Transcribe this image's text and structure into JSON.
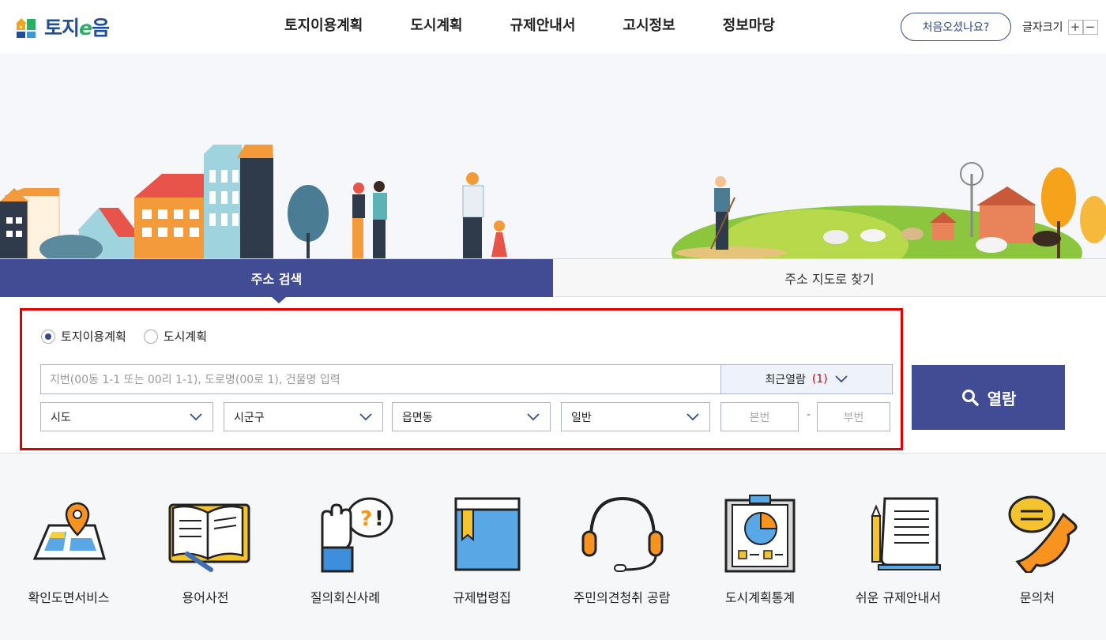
{
  "header": {
    "logo_text_a": "토지",
    "logo_text_e": "e",
    "logo_text_b": "음",
    "nav": [
      "토지이용계획",
      "도시계획",
      "규제안내서",
      "고시정보",
      "정보마당"
    ],
    "first_visit": "처음오셨나요?",
    "fontsize_label": "글자크기",
    "fontsize_plus": "+",
    "fontsize_minus": "−"
  },
  "search": {
    "tabs": [
      "주소 검색",
      "주소 지도로 찾기"
    ],
    "active_tab": 0,
    "radio_options": [
      "토지이용계획",
      "도시계획"
    ],
    "selected_radio": 0,
    "address_placeholder": "지번(00동 1-1 또는 00리 1-1), 도로명(00로 1), 건물명 입력",
    "recent_label": "최근열람",
    "recent_count": "(1)",
    "selects": [
      "시도",
      "시군구",
      "읍면동",
      "일반"
    ],
    "main_no_placeholder": "본번",
    "sub_no_placeholder": "부번",
    "dash": "-",
    "submit_label": "열람"
  },
  "quick_menu": [
    {
      "label": "확인도면서비스",
      "icon": "map-pin-icon"
    },
    {
      "label": "용어사전",
      "icon": "open-book-icon"
    },
    {
      "label": "질의회신사례",
      "icon": "question-hand-icon"
    },
    {
      "label": "규제법령집",
      "icon": "law-book-icon"
    },
    {
      "label": "주민의견청취 공람",
      "icon": "headset-icon"
    },
    {
      "label": "도시계획통계",
      "icon": "statistics-board-icon"
    },
    {
      "label": "쉬운 규제안내서",
      "icon": "document-pencil-icon"
    },
    {
      "label": "문의처",
      "icon": "phone-chat-icon"
    }
  ],
  "colors": {
    "primary": "#414c94",
    "highlight_border": "#e00000",
    "recent_count": "#d20000"
  }
}
